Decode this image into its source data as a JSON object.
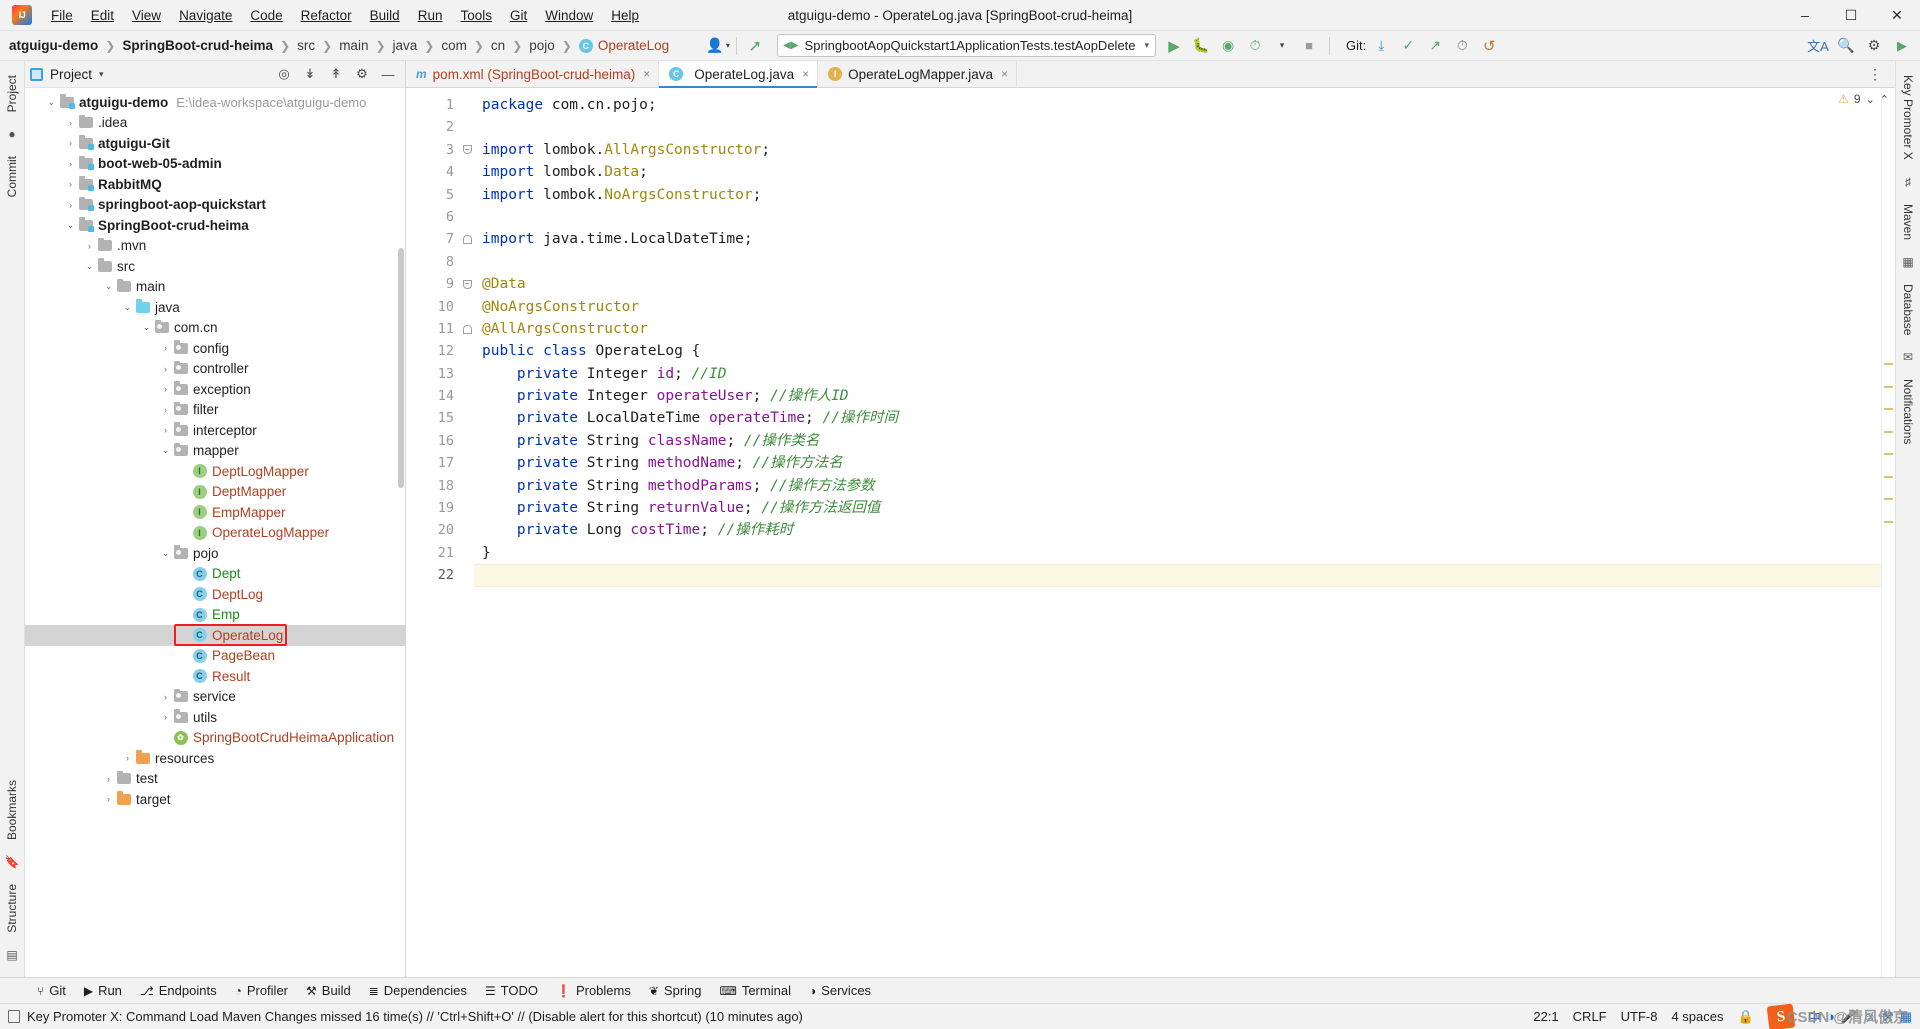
{
  "titlebar": {
    "logo_icon": "intellij-idea-logo",
    "window_title": "atguigu-demo - OperateLog.java [SpringBoot-crud-heima]",
    "menus": [
      "File",
      "Edit",
      "View",
      "Navigate",
      "Code",
      "Refactor",
      "Build",
      "Run",
      "Tools",
      "Git",
      "Window",
      "Help"
    ],
    "minimize_icon": "minimize-icon",
    "maximize_icon": "maximize-icon",
    "close_icon": "close-icon"
  },
  "navbar": {
    "crumbs": [
      "atguigu-demo",
      "SpringBoot-crud-heima",
      "src",
      "main",
      "java",
      "com",
      "cn",
      "pojo",
      "OperateLog"
    ],
    "class_badge": "C",
    "avatar_icon": "user-avatar-icon",
    "build_icon": "hammer-build-icon",
    "run_config": {
      "label": "SpringbootAopQuickstart1ApplicationTests.testAopDelete",
      "caret": "▾",
      "config_icon": "run-config-icon"
    },
    "run_icon": "run-play-icon",
    "debug_icon": "debug-bug-icon",
    "coverage_icon": "run-coverage-icon",
    "profile_icon": "run-profiler-icon",
    "profile_caret": "▾",
    "stop_icon": "stop-icon",
    "git_label": "Git:",
    "git_update_icon": "git-update-icon",
    "git_commit_icon": "git-commit-check-icon",
    "git_push_icon": "git-push-icon",
    "history_icon": "history-clock-icon",
    "undo_icon": "undo-icon",
    "translate_icon": "translate-icon",
    "search_icon": "search-icon",
    "settings_icon": "gear-icon",
    "more_icon": "more-run-icon"
  },
  "left_strip": {
    "project_tab": "Project",
    "commit_tab": "Commit",
    "bookmarks_tab": "Bookmarks",
    "structure_tab": "Structure"
  },
  "right_strip": {
    "key_promoter_tab": "Key Promoter X",
    "maven_tab": "Maven",
    "database_tab": "Database",
    "notifications_tab": "Notifications"
  },
  "project_panel": {
    "title": "Project",
    "caret": "▾",
    "actions": [
      "target-icon",
      "expand-all-icon",
      "collapse-all-icon",
      "gear-icon",
      "hide-icon"
    ],
    "tree": [
      {
        "depth": 0,
        "arrow": "⌄",
        "icon": "module-folder",
        "label": "atguigu-demo",
        "style": "bold",
        "hint": "E:\\idea-workspace\\atguigu-demo"
      },
      {
        "depth": 1,
        "arrow": "›",
        "icon": "folder",
        "label": ".idea",
        "style": "plain"
      },
      {
        "depth": 1,
        "arrow": "›",
        "icon": "module-folder",
        "label": "atguigu-Git",
        "style": "bold"
      },
      {
        "depth": 1,
        "arrow": "›",
        "icon": "module-folder",
        "label": "boot-web-05-admin",
        "style": "bold"
      },
      {
        "depth": 1,
        "arrow": "›",
        "icon": "module-folder",
        "label": "RabbitMQ",
        "style": "bold"
      },
      {
        "depth": 1,
        "arrow": "›",
        "icon": "module-folder",
        "label": "springboot-aop-quickstart",
        "style": "bold"
      },
      {
        "depth": 1,
        "arrow": "⌄",
        "icon": "module-folder",
        "label": "SpringBoot-crud-heima",
        "style": "bold"
      },
      {
        "depth": 2,
        "arrow": "›",
        "icon": "folder",
        "label": ".mvn",
        "style": "plain"
      },
      {
        "depth": 2,
        "arrow": "⌄",
        "icon": "folder",
        "label": "src",
        "style": "plain"
      },
      {
        "depth": 3,
        "arrow": "⌄",
        "icon": "folder",
        "label": "main",
        "style": "plain"
      },
      {
        "depth": 4,
        "arrow": "⌄",
        "icon": "source-folder",
        "label": "java",
        "style": "plain"
      },
      {
        "depth": 5,
        "arrow": "⌄",
        "icon": "package-folder",
        "label": "com.cn",
        "style": "plain"
      },
      {
        "depth": 6,
        "arrow": "›",
        "icon": "package-folder",
        "label": "config",
        "style": "plain"
      },
      {
        "depth": 6,
        "arrow": "›",
        "icon": "package-folder",
        "label": "controller",
        "style": "plain"
      },
      {
        "depth": 6,
        "arrow": "›",
        "icon": "package-folder",
        "label": "exception",
        "style": "plain"
      },
      {
        "depth": 6,
        "arrow": "›",
        "icon": "package-folder",
        "label": "filter",
        "style": "plain"
      },
      {
        "depth": 6,
        "arrow": "›",
        "icon": "package-folder",
        "label": "interceptor",
        "style": "plain"
      },
      {
        "depth": 6,
        "arrow": "⌄",
        "icon": "package-folder",
        "label": "mapper",
        "style": "plain"
      },
      {
        "depth": 7,
        "arrow": "",
        "icon": "interface-badge",
        "label": "DeptLogMapper",
        "style": "iface"
      },
      {
        "depth": 7,
        "arrow": "",
        "icon": "interface-badge",
        "label": "DeptMapper",
        "style": "iface"
      },
      {
        "depth": 7,
        "arrow": "",
        "icon": "interface-badge",
        "label": "EmpMapper",
        "style": "iface"
      },
      {
        "depth": 7,
        "arrow": "",
        "icon": "interface-badge",
        "label": "OperateLogMapper",
        "style": "iface"
      },
      {
        "depth": 6,
        "arrow": "⌄",
        "icon": "package-folder",
        "label": "pojo",
        "style": "plain"
      },
      {
        "depth": 7,
        "arrow": "",
        "icon": "class-badge",
        "label": "Dept",
        "style": "cls-green"
      },
      {
        "depth": 7,
        "arrow": "",
        "icon": "class-badge",
        "label": "DeptLog",
        "style": "cls-brown"
      },
      {
        "depth": 7,
        "arrow": "",
        "icon": "class-badge",
        "label": "Emp",
        "style": "cls-green"
      },
      {
        "depth": 7,
        "arrow": "",
        "icon": "class-badge",
        "label": "OperateLog",
        "style": "cls-brown",
        "selected": true,
        "highlighted": true
      },
      {
        "depth": 7,
        "arrow": "",
        "icon": "class-badge",
        "label": "PageBean",
        "style": "cls-brown"
      },
      {
        "depth": 7,
        "arrow": "",
        "icon": "class-badge",
        "label": "Result",
        "style": "cls-brown"
      },
      {
        "depth": 6,
        "arrow": "›",
        "icon": "package-folder",
        "label": "service",
        "style": "plain"
      },
      {
        "depth": 6,
        "arrow": "›",
        "icon": "package-folder",
        "label": "utils",
        "style": "plain"
      },
      {
        "depth": 6,
        "arrow": "",
        "icon": "spring-badge",
        "label": "SpringBootCrudHeimaApplication",
        "style": "spring"
      },
      {
        "depth": 4,
        "arrow": "›",
        "icon": "resource-folder",
        "label": "resources",
        "style": "plain"
      },
      {
        "depth": 3,
        "arrow": "›",
        "icon": "folder",
        "label": "test",
        "style": "plain"
      },
      {
        "depth": 3,
        "arrow": "›",
        "icon": "resource-folder",
        "label": "target",
        "style": "plain"
      }
    ]
  },
  "editor": {
    "tabs": [
      {
        "label": "pom.xml (SpringBoot-crud-heima)",
        "icon": "maven-m-icon",
        "active": false,
        "close": "×"
      },
      {
        "label": "OperateLog.java",
        "icon": "class-c-icon",
        "active": true,
        "close": "×"
      },
      {
        "label": "OperateLogMapper.java",
        "icon": "interface-i-icon",
        "active": false,
        "close": "×"
      }
    ],
    "more_tabs_icon": "more-options-icon",
    "inspection": {
      "warning_count": "9",
      "warning_icon": "warning-triangle-icon",
      "caret_down": "⌄",
      "caret_up": "⌃"
    },
    "caret_line": 22,
    "lines": [
      {
        "n": 1,
        "tokens": [
          {
            "t": "package ",
            "c": "kw"
          },
          {
            "t": "com.cn.pojo;",
            "c": "plain"
          }
        ]
      },
      {
        "n": 2,
        "tokens": []
      },
      {
        "n": 3,
        "fold": "open",
        "tokens": [
          {
            "t": "import ",
            "c": "kw"
          },
          {
            "t": "lombok.",
            "c": "plain"
          },
          {
            "t": "AllArgsConstructor",
            "c": "ann"
          },
          {
            "t": ";",
            "c": "plain"
          }
        ]
      },
      {
        "n": 4,
        "tokens": [
          {
            "t": "import ",
            "c": "kw"
          },
          {
            "t": "lombok.",
            "c": "plain"
          },
          {
            "t": "Data",
            "c": "ann"
          },
          {
            "t": ";",
            "c": "plain"
          }
        ]
      },
      {
        "n": 5,
        "tokens": [
          {
            "t": "import ",
            "c": "kw"
          },
          {
            "t": "lombok.",
            "c": "plain"
          },
          {
            "t": "NoArgsConstructor",
            "c": "ann"
          },
          {
            "t": ";",
            "c": "plain"
          }
        ]
      },
      {
        "n": 6,
        "tokens": []
      },
      {
        "n": 7,
        "fold": "close",
        "tokens": [
          {
            "t": "import ",
            "c": "kw"
          },
          {
            "t": "java.time.LocalDateTime;",
            "c": "plain"
          }
        ]
      },
      {
        "n": 8,
        "tokens": []
      },
      {
        "n": 9,
        "fold": "open",
        "tokens": [
          {
            "t": "@Data",
            "c": "ann"
          }
        ]
      },
      {
        "n": 10,
        "tokens": [
          {
            "t": "@NoArgsConstructor",
            "c": "ann"
          }
        ]
      },
      {
        "n": 11,
        "fold": "close",
        "tokens": [
          {
            "t": "@AllArgsConstructor",
            "c": "ann"
          }
        ]
      },
      {
        "n": 12,
        "tokens": [
          {
            "t": "public ",
            "c": "kw"
          },
          {
            "t": "class ",
            "c": "kw"
          },
          {
            "t": "OperateLog",
            "c": "typ"
          },
          {
            "t": " {",
            "c": "plain"
          }
        ]
      },
      {
        "n": 13,
        "tokens": [
          {
            "t": "    ",
            "c": "plain"
          },
          {
            "t": "private ",
            "c": "kw"
          },
          {
            "t": "Integer ",
            "c": "typ"
          },
          {
            "t": "id",
            "c": "fld"
          },
          {
            "t": "; ",
            "c": "plain"
          },
          {
            "t": "//ID",
            "c": "cmt"
          }
        ]
      },
      {
        "n": 14,
        "tokens": [
          {
            "t": "    ",
            "c": "plain"
          },
          {
            "t": "private ",
            "c": "kw"
          },
          {
            "t": "Integer ",
            "c": "typ"
          },
          {
            "t": "operateUser",
            "c": "fld"
          },
          {
            "t": "; ",
            "c": "plain"
          },
          {
            "t": "//操作人ID",
            "c": "cmt"
          }
        ]
      },
      {
        "n": 15,
        "tokens": [
          {
            "t": "    ",
            "c": "plain"
          },
          {
            "t": "private ",
            "c": "kw"
          },
          {
            "t": "LocalDateTime ",
            "c": "typ"
          },
          {
            "t": "operateTime",
            "c": "fld"
          },
          {
            "t": "; ",
            "c": "plain"
          },
          {
            "t": "//操作时间",
            "c": "cmt"
          }
        ]
      },
      {
        "n": 16,
        "tokens": [
          {
            "t": "    ",
            "c": "plain"
          },
          {
            "t": "private ",
            "c": "kw"
          },
          {
            "t": "String ",
            "c": "typ"
          },
          {
            "t": "className",
            "c": "fld"
          },
          {
            "t": "; ",
            "c": "plain"
          },
          {
            "t": "//操作类名",
            "c": "cmt"
          }
        ]
      },
      {
        "n": 17,
        "tokens": [
          {
            "t": "    ",
            "c": "plain"
          },
          {
            "t": "private ",
            "c": "kw"
          },
          {
            "t": "String ",
            "c": "typ"
          },
          {
            "t": "methodName",
            "c": "fld"
          },
          {
            "t": "; ",
            "c": "plain"
          },
          {
            "t": "//操作方法名",
            "c": "cmt"
          }
        ]
      },
      {
        "n": 18,
        "tokens": [
          {
            "t": "    ",
            "c": "plain"
          },
          {
            "t": "private ",
            "c": "kw"
          },
          {
            "t": "String ",
            "c": "typ"
          },
          {
            "t": "methodParams",
            "c": "fld"
          },
          {
            "t": "; ",
            "c": "plain"
          },
          {
            "t": "//操作方法参数",
            "c": "cmt"
          }
        ]
      },
      {
        "n": 19,
        "tokens": [
          {
            "t": "    ",
            "c": "plain"
          },
          {
            "t": "private ",
            "c": "kw"
          },
          {
            "t": "String ",
            "c": "typ"
          },
          {
            "t": "returnValue",
            "c": "fld"
          },
          {
            "t": "; ",
            "c": "plain"
          },
          {
            "t": "//操作方法返回值",
            "c": "cmt"
          }
        ]
      },
      {
        "n": 20,
        "tokens": [
          {
            "t": "    ",
            "c": "plain"
          },
          {
            "t": "private ",
            "c": "kw"
          },
          {
            "t": "Long ",
            "c": "typ"
          },
          {
            "t": "costTime",
            "c": "fld"
          },
          {
            "t": "; ",
            "c": "plain"
          },
          {
            "t": "//操作耗时",
            "c": "cmt"
          }
        ]
      },
      {
        "n": 21,
        "tokens": [
          {
            "t": "}",
            "c": "plain"
          }
        ]
      },
      {
        "n": 22,
        "tokens": []
      }
    ]
  },
  "bottom_bar": {
    "items": [
      {
        "label": "Git",
        "icon": "git-branch-icon"
      },
      {
        "label": "Run",
        "icon": "run-play-icon"
      },
      {
        "label": "Endpoints",
        "icon": "endpoints-icon"
      },
      {
        "label": "Profiler",
        "icon": "profiler-icon"
      },
      {
        "label": "Build",
        "icon": "hammer-build-icon"
      },
      {
        "label": "Dependencies",
        "icon": "dependencies-icon"
      },
      {
        "label": "TODO",
        "icon": "todo-list-icon"
      },
      {
        "label": "Problems",
        "icon": "problems-icon"
      },
      {
        "label": "Spring",
        "icon": "spring-leaf-icon"
      },
      {
        "label": "Terminal",
        "icon": "terminal-icon"
      },
      {
        "label": "Services",
        "icon": "services-icon"
      }
    ]
  },
  "status_bar": {
    "message": "Key Promoter X: Command Load Maven Changes missed 16 time(s) // 'Ctrl+Shift+O' // (Disable alert for this shortcut) (10 minutes ago)",
    "message_icon": "notification-note-icon",
    "caret_position": "22:1",
    "line_separator": "CRLF",
    "encoding": "UTF-8",
    "indent": "4 spaces",
    "lock_icon": "lock-icon",
    "ime": {
      "sogou_icon": "sogou-pinyin-icon",
      "mode": "中",
      "items": [
        "ime-menu-icon",
        "ime-voice-icon",
        "ime-emoji-icon",
        "ime-tool-icon",
        "ime-apps-icon"
      ]
    },
    "watermark": "CSDN @清风傲京"
  }
}
